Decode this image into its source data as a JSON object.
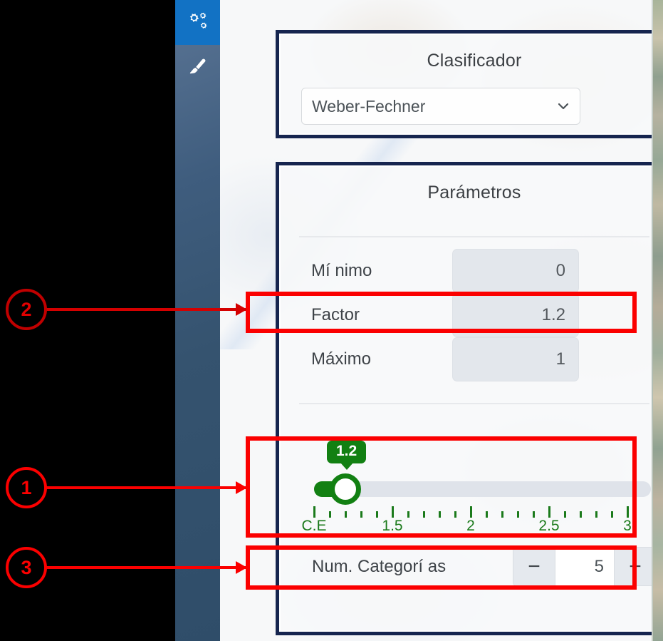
{
  "sidebar": {
    "items": [
      {
        "icon": "cogs-icon",
        "active": true
      },
      {
        "icon": "paintbrush-icon",
        "active": false
      }
    ]
  },
  "clasificador": {
    "title": "Clasificador",
    "select": {
      "value": "Weber-Fechner",
      "icon": "chevron-down-icon"
    }
  },
  "parametros": {
    "title": "Parámetros",
    "rows": [
      {
        "label": "Mí nimo",
        "value": "0"
      },
      {
        "label": "Factor",
        "value": "1.2"
      },
      {
        "label": "Máximo",
        "value": "1"
      }
    ],
    "slider": {
      "tooltip": "1.2",
      "value": 1.2,
      "min": 1.0,
      "max": 3.15,
      "fill_color": "#128012",
      "track_color": "#dfe3ea",
      "tick_labels": [
        {
          "text": "C.E",
          "value": 1.0
        },
        {
          "text": "1.5",
          "value": 1.5
        },
        {
          "text": "2",
          "value": 2.0
        },
        {
          "text": "2.5",
          "value": 2.5
        },
        {
          "text": "3",
          "value": 3.0
        }
      ],
      "major_tick_values": [
        1.0,
        1.5,
        2.0,
        2.5,
        3.0
      ],
      "minor_tick_values": [
        1.1,
        1.2,
        1.3,
        1.4,
        1.6,
        1.7,
        1.8,
        1.9,
        2.1,
        2.2,
        2.3,
        2.4,
        2.6,
        2.7,
        2.8,
        2.9
      ]
    },
    "categorias": {
      "label": "Num. Categorí as",
      "decrement_label": "−",
      "value": "5",
      "increment_label": "+"
    }
  },
  "annotations": {
    "callouts": [
      {
        "number": "1",
        "target": "slider-block"
      },
      {
        "number": "2",
        "target": "factor-row"
      },
      {
        "number": "3",
        "target": "num-categorias-row"
      }
    ],
    "highlight_color": "#fb0000"
  },
  "theme": {
    "card_border": "#16254f",
    "rail_active": "#1272c4",
    "accent_green": "#128012"
  }
}
